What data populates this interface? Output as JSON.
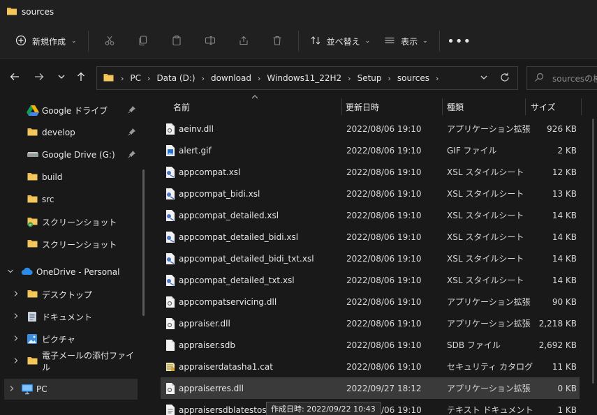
{
  "window": {
    "title": "sources"
  },
  "toolbar": {
    "new_label": "新規作成",
    "sort_label": "並べ替え",
    "view_label": "表示"
  },
  "address": {
    "crumbs": [
      "PC",
      "Data (D:)",
      "download",
      "Windows11_22H2",
      "Setup",
      "sources"
    ]
  },
  "search": {
    "placeholder": "sourcesの検索"
  },
  "sidebar": {
    "items": [
      {
        "label": "Google ドライブ"
      },
      {
        "label": "develop"
      },
      {
        "label": "Google Drive (G:)"
      },
      {
        "label": "build"
      },
      {
        "label": "src"
      },
      {
        "label": "スクリーンショット"
      },
      {
        "label": "スクリーンショット"
      },
      {
        "label": "OneDrive - Personal"
      },
      {
        "label": "デスクトップ"
      },
      {
        "label": "ドキュメント"
      },
      {
        "label": "ピクチャ"
      },
      {
        "label": "電子メールの添付ファイル"
      },
      {
        "label": "PC"
      }
    ]
  },
  "columns": {
    "name": "名前",
    "date": "更新日時",
    "type": "種類",
    "size": "サイズ"
  },
  "files": [
    {
      "name": "aeinv.dll",
      "date": "2022/08/06 19:10",
      "type": "アプリケーション拡張",
      "size": "926 KB"
    },
    {
      "name": "alert.gif",
      "date": "2022/08/06 19:10",
      "type": "GIF ファイル",
      "size": "2 KB"
    },
    {
      "name": "appcompat.xsl",
      "date": "2022/08/06 19:10",
      "type": "XSL スタイルシート",
      "size": "12 KB"
    },
    {
      "name": "appcompat_bidi.xsl",
      "date": "2022/08/06 19:10",
      "type": "XSL スタイルシート",
      "size": "13 KB"
    },
    {
      "name": "appcompat_detailed.xsl",
      "date": "2022/08/06 19:10",
      "type": "XSL スタイルシート",
      "size": "14 KB"
    },
    {
      "name": "appcompat_detailed_bidi.xsl",
      "date": "2022/08/06 19:10",
      "type": "XSL スタイルシート",
      "size": "14 KB"
    },
    {
      "name": "appcompat_detailed_bidi_txt.xsl",
      "date": "2022/08/06 19:10",
      "type": "XSL スタイルシート",
      "size": "14 KB"
    },
    {
      "name": "appcompat_detailed_txt.xsl",
      "date": "2022/08/06 19:10",
      "type": "XSL スタイルシート",
      "size": "14 KB"
    },
    {
      "name": "appcompatservicing.dll",
      "date": "2022/08/06 19:10",
      "type": "アプリケーション拡張",
      "size": "90 KB"
    },
    {
      "name": "appraiser.dll",
      "date": "2022/08/06 19:10",
      "type": "アプリケーション拡張",
      "size": "2,218 KB"
    },
    {
      "name": "appraiser.sdb",
      "date": "2022/08/06 19:10",
      "type": "SDB ファイル",
      "size": "2,692 KB"
    },
    {
      "name": "appraiserdatasha1.cat",
      "date": "2022/08/06 19:10",
      "type": "セキュリティ カタログ",
      "size": "11 KB"
    },
    {
      "name": "appraiserres.dll",
      "date": "2022/09/27 18:12",
      "type": "アプリケーション拡張",
      "size": "0 KB"
    },
    {
      "name": "appraisersdblatestoshas",
      "date": "/06 19:10",
      "type": "テキスト ドキュメント",
      "size": "1 KB"
    }
  ],
  "tooltip": {
    "text": "作成日時: 2022/09/22 10:43"
  },
  "colors": {
    "background": "#191919",
    "chrome": "#202020",
    "selected_row": "#3a3a3a",
    "folder": "#e8b64a",
    "onedrive": "#2b8be6"
  }
}
